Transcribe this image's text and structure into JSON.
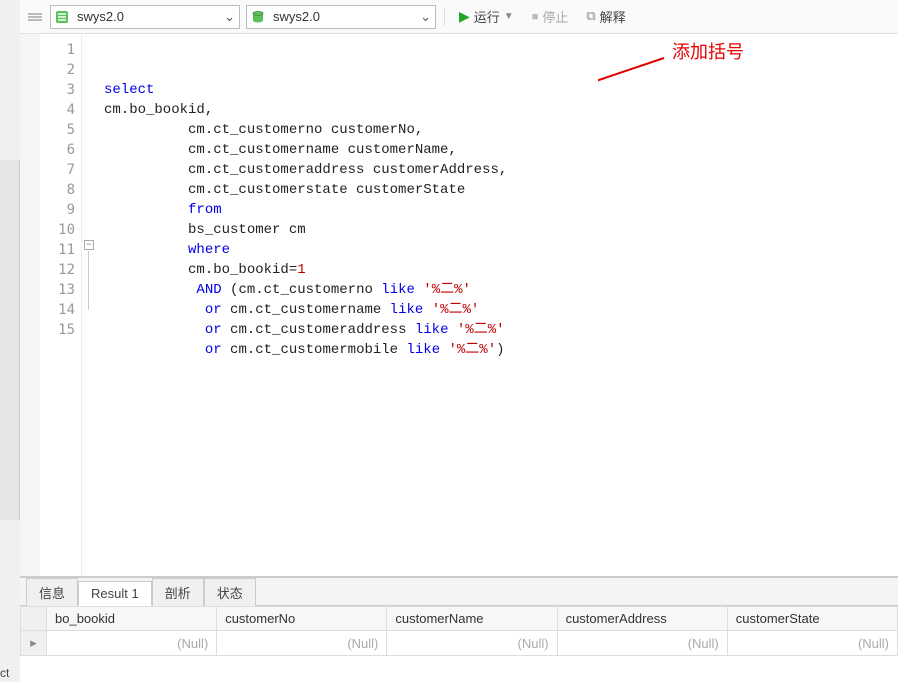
{
  "toolbar": {
    "conn_select": "swys2.0",
    "db_select": "swys2.0",
    "run_label": "运行",
    "stop_label": "停止",
    "explain_label": "解释"
  },
  "editor": {
    "lines": [
      {
        "n": "1",
        "segs": [
          {
            "cls": "kw",
            "t": "select"
          }
        ]
      },
      {
        "n": "2",
        "segs": [
          {
            "cls": "pn",
            "t": "cm.bo_bookid,"
          }
        ]
      },
      {
        "n": "3",
        "segs": [
          {
            "cls": "pn",
            "t": "          cm.ct_customerno customerNo,"
          }
        ]
      },
      {
        "n": "4",
        "segs": [
          {
            "cls": "pn",
            "t": "          cm.ct_customername customerName,"
          }
        ]
      },
      {
        "n": "5",
        "segs": [
          {
            "cls": "pn",
            "t": "          cm.ct_customeraddress customerAddress,"
          }
        ]
      },
      {
        "n": "6",
        "segs": [
          {
            "cls": "pn",
            "t": "          cm.ct_customerstate customerState"
          }
        ]
      },
      {
        "n": "7",
        "segs": [
          {
            "cls": "pn",
            "t": "          "
          },
          {
            "cls": "kw",
            "t": "from"
          }
        ]
      },
      {
        "n": "8",
        "segs": [
          {
            "cls": "pn",
            "t": "          bs_customer cm"
          }
        ]
      },
      {
        "n": "9",
        "segs": [
          {
            "cls": "pn",
            "t": "          "
          },
          {
            "cls": "kw",
            "t": "where"
          }
        ]
      },
      {
        "n": "10",
        "segs": [
          {
            "cls": "pn",
            "t": "          cm.bo_bookid="
          },
          {
            "cls": "num",
            "t": "1"
          }
        ]
      },
      {
        "n": "11",
        "segs": [
          {
            "cls": "pn",
            "t": "           "
          },
          {
            "cls": "kw",
            "t": "AND"
          },
          {
            "cls": "pn",
            "t": " (cm.ct_customerno "
          },
          {
            "cls": "kw",
            "t": "like"
          },
          {
            "cls": "pn",
            "t": " "
          },
          {
            "cls": "str",
            "t": "'%二%'"
          }
        ]
      },
      {
        "n": "12",
        "segs": [
          {
            "cls": "pn",
            "t": "            "
          },
          {
            "cls": "kw",
            "t": "or"
          },
          {
            "cls": "pn",
            "t": " cm.ct_customername "
          },
          {
            "cls": "kw",
            "t": "like"
          },
          {
            "cls": "pn",
            "t": " "
          },
          {
            "cls": "str",
            "t": "'%二%'"
          }
        ]
      },
      {
        "n": "13",
        "segs": [
          {
            "cls": "pn",
            "t": "            "
          },
          {
            "cls": "kw",
            "t": "or"
          },
          {
            "cls": "pn",
            "t": " cm.ct_customeraddress "
          },
          {
            "cls": "kw",
            "t": "like"
          },
          {
            "cls": "pn",
            "t": " "
          },
          {
            "cls": "str",
            "t": "'%二%'"
          }
        ]
      },
      {
        "n": "14",
        "segs": [
          {
            "cls": "pn",
            "t": "            "
          },
          {
            "cls": "kw",
            "t": "or"
          },
          {
            "cls": "pn",
            "t": " cm.ct_customermobile "
          },
          {
            "cls": "kw",
            "t": "like"
          },
          {
            "cls": "pn",
            "t": " "
          },
          {
            "cls": "str",
            "t": "'%二%'"
          },
          {
            "cls": "pn",
            "t": ")"
          }
        ]
      },
      {
        "n": "15",
        "segs": [
          {
            "cls": "pn",
            "t": ""
          }
        ]
      }
    ],
    "annotation_text": "添加括号"
  },
  "results": {
    "tabs": [
      "信息",
      "Result 1",
      "剖析",
      "状态"
    ],
    "active_tab": 1,
    "columns": [
      "bo_bookid",
      "customerNo",
      "customerName",
      "customerAddress",
      "customerState"
    ],
    "rows": [
      [
        "(Null)",
        "(Null)",
        "(Null)",
        "(Null)",
        "(Null)"
      ]
    ]
  },
  "bottom_label": "ct"
}
